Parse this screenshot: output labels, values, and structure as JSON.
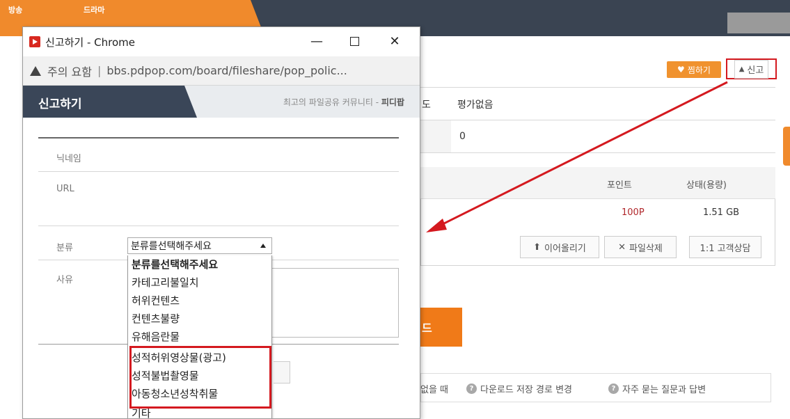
{
  "background": {
    "top_tabs": [
      "방송",
      "드라마"
    ],
    "bookmark_label": "찜하기",
    "report_label": "신고",
    "rating_label_fragment": "도",
    "rating_value": "평가없음",
    "count_value": "0",
    "table": {
      "col_point": "포인트",
      "col_status": "상태(용량)",
      "point_value": "100P",
      "size_value": "1.51 GB"
    },
    "buttons": {
      "resume_upload": "이어올리기",
      "delete_file": "파일삭제",
      "support": "1:1 고객상담"
    },
    "download_fragment": "드",
    "help": {
      "fragment": "없을 때",
      "change_path": "다운로드 저장 경로 변경",
      "faq": "자주 묻는 질문과 답변"
    }
  },
  "popup": {
    "window_title": "신고하기 - Chrome",
    "warning_label": "주의 요함",
    "url": "bbs.pdpop.com/board/fileshare/pop_polic...",
    "header_title": "신고하기",
    "header_tagline": "최고의 파일공유 커뮤니티 - ",
    "header_brand": "피디팝",
    "form": {
      "nickname_label": "닉네임",
      "url_label": "URL",
      "category_label": "분류",
      "reason_label": "사유",
      "category_selected": "분류를선택해주세요"
    },
    "dropdown_options": [
      "분류를선택해주세요",
      "카테고리불일치",
      "허위컨텐츠",
      "컨텐츠불량",
      "유해음란물",
      "성적허위영상물(광고)",
      "성적불법촬영물",
      "아동청소년성착취물",
      "기타"
    ]
  },
  "colors": {
    "accent_orange": "#f08a2c",
    "highlight_red": "#d4191f",
    "header_dark": "#3a4658"
  }
}
